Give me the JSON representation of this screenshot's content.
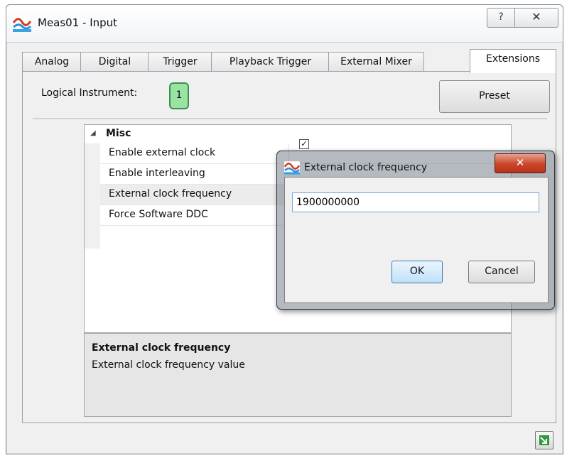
{
  "window": {
    "title": "Meas01 - Input",
    "help_glyph": "?",
    "close_glyph": "✕"
  },
  "tabs": [
    {
      "label": "Analog",
      "active": false
    },
    {
      "label": "Digital",
      "active": false
    },
    {
      "label": "Trigger",
      "active": false
    },
    {
      "label": "Playback Trigger",
      "active": false
    },
    {
      "label": "External Mixer",
      "active": false
    },
    {
      "label": "Extensions",
      "active": true
    }
  ],
  "logical_instrument": {
    "label": "Logical Instrument:",
    "value": "1"
  },
  "preset_label": "Preset",
  "property_grid": {
    "category": "Misc",
    "items": [
      {
        "name": "Enable external clock",
        "checked": true
      },
      {
        "name": "Enable interleaving"
      },
      {
        "name": "External clock frequency",
        "selected": true
      },
      {
        "name": "Force Software DDC"
      }
    ]
  },
  "help_panel": {
    "title": "External clock frequency",
    "description": "External clock frequency value"
  },
  "dialog": {
    "title": "External clock frequency",
    "close_glyph": "✕",
    "input_value": "1900000000",
    "ok_label": "OK",
    "cancel_label": "Cancel"
  },
  "colors": {
    "badge_fill": "#98e4a0",
    "badge_border": "#3f8f56",
    "close_button_red": "#c9452a"
  },
  "icons": {
    "app": "waveform-app-icon",
    "corner": "export-arrow-icon"
  }
}
